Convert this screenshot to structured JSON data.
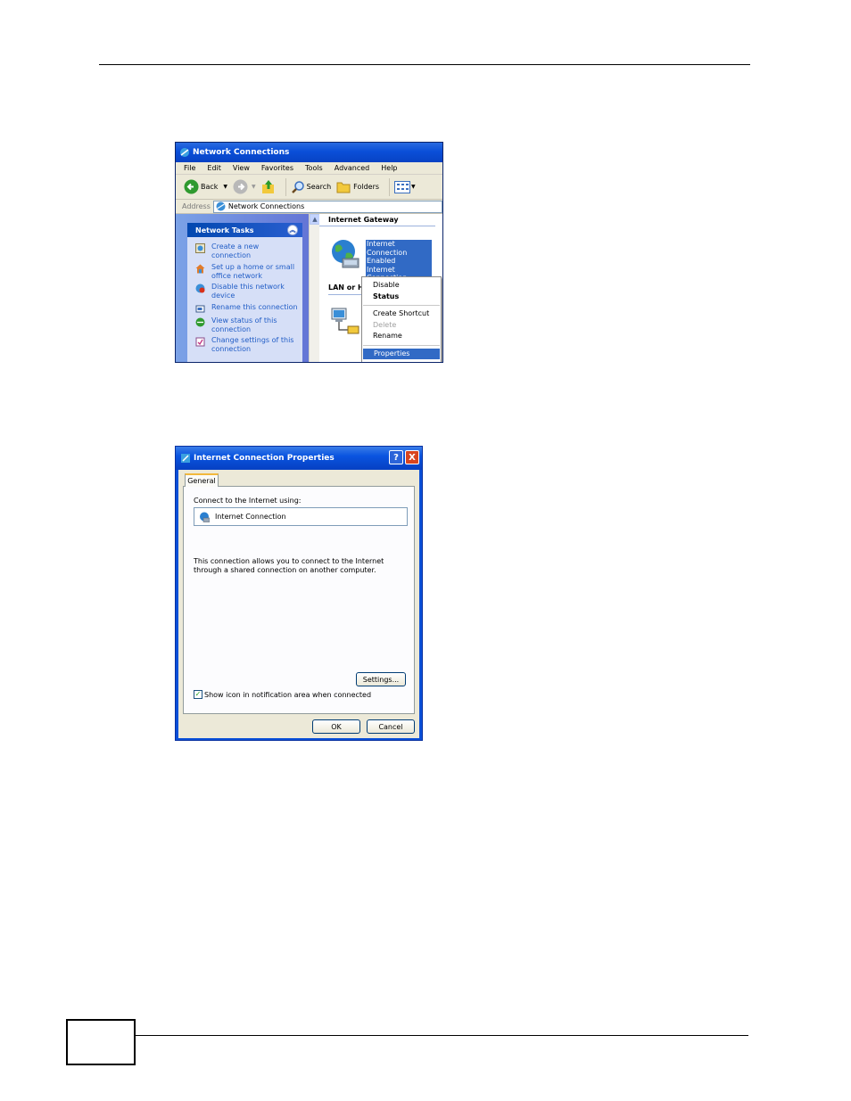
{
  "network_connections": {
    "title": "Network Connections",
    "menu": [
      "File",
      "Edit",
      "View",
      "Favorites",
      "Tools",
      "Advanced",
      "Help"
    ],
    "toolbar": {
      "back": "Back",
      "search": "Search",
      "folders": "Folders"
    },
    "address": {
      "label": "Address",
      "value": "Network Connections"
    },
    "tasks": {
      "heading": "Network Tasks",
      "items": [
        {
          "line1": "Create a new",
          "line2": "connection"
        },
        {
          "line1": "Set up a home or small",
          "line2": "office network"
        },
        {
          "line1": "Disable this network",
          "line2": "device"
        },
        {
          "line1": "Rename this connection",
          "line2": ""
        },
        {
          "line1": "View status of this",
          "line2": "connection"
        },
        {
          "line1": "Change settings of this",
          "line2": "connection"
        }
      ]
    },
    "group_gateway": "Internet Gateway",
    "selected_item": {
      "name": "Internet Connection",
      "status": "Enabled",
      "type": "Internet Connection"
    },
    "group_lan": "LAN or H",
    "context_menu": {
      "disable": "Disable",
      "status": "Status",
      "create_shortcut": "Create Shortcut",
      "delete": "Delete",
      "rename": "Rename",
      "properties": "Properties"
    }
  },
  "properties_dialog": {
    "title": "Internet Connection Properties",
    "help": "?",
    "close": "X",
    "tab": "General",
    "connect_label": "Connect to the Internet using:",
    "connection_name": "Internet Connection",
    "description": "This connection allows you to connect to the Internet through a shared connection on another computer.",
    "settings_button": "Settings...",
    "show_icon_label": "Show icon in notification area when connected",
    "show_icon_checked": true,
    "ok": "OK",
    "cancel": "Cancel"
  }
}
